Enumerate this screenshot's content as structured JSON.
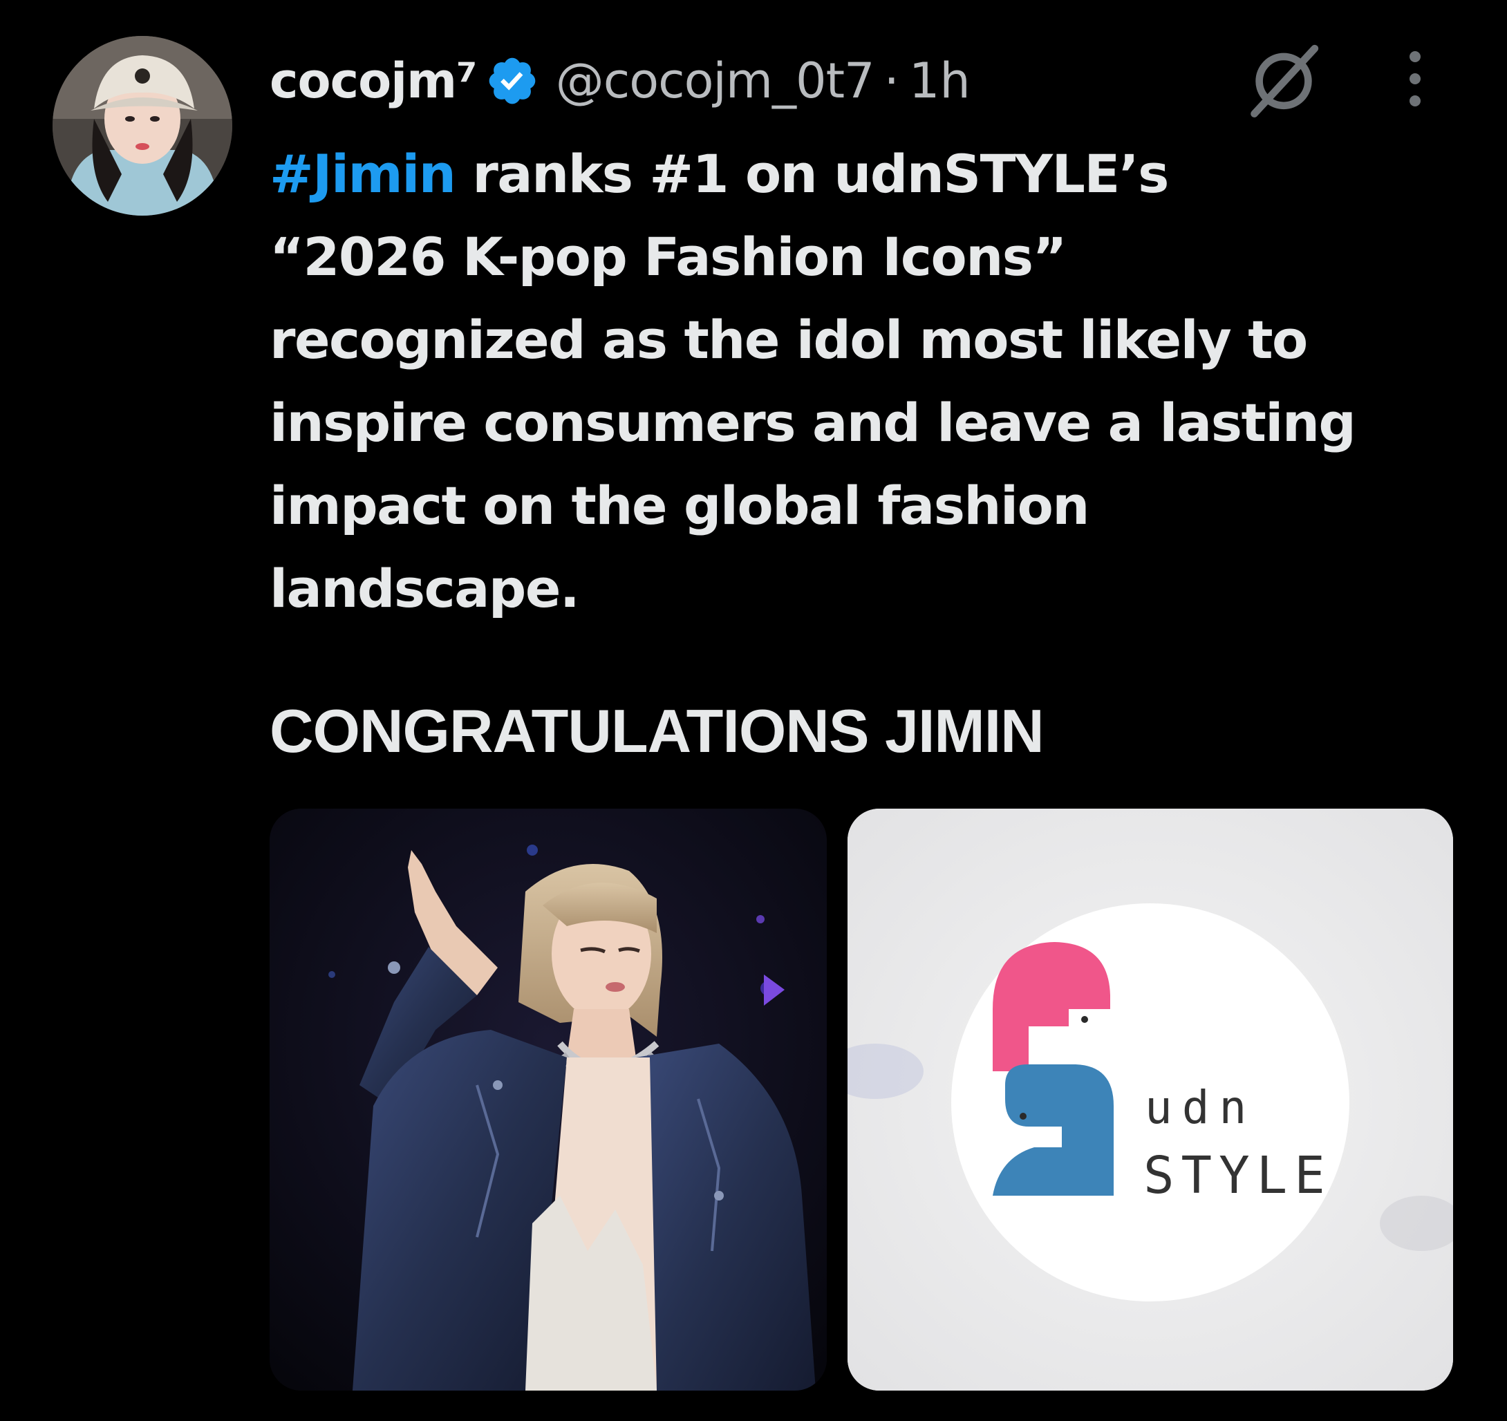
{
  "tweet": {
    "display_name": "cocojm⁷",
    "handle": "@cocojm_0t7",
    "separator": "·",
    "time": "1h",
    "body": {
      "hashtag": "#Jimin",
      "line1_rest": " ranks #1 on udnSTYLE’s",
      "line2": "“2026 K-pop Fashion Icons”",
      "line3": "recognized as the idol most likely to",
      "line4": "inspire consumers and leave a lasting",
      "line5": "impact on the global fashion",
      "line6": "landscape."
    },
    "congrats": "CONGRATULATIONS JIMIN",
    "media": {
      "left_image": "jimin-performance-photo",
      "right_image": {
        "logo_line1": "udn",
        "logo_line2": "STYLE"
      }
    }
  },
  "icons": {
    "verified": "verified-badge-icon",
    "grok": "grok-icon",
    "more": "more-options-icon"
  },
  "colors": {
    "background": "#000000",
    "text": "#e7e9ea",
    "secondary_text": "#b9bcbf",
    "hashtag": "#1d9bf0",
    "logo_pink": "#f0568a",
    "logo_blue": "#3d84b8"
  }
}
